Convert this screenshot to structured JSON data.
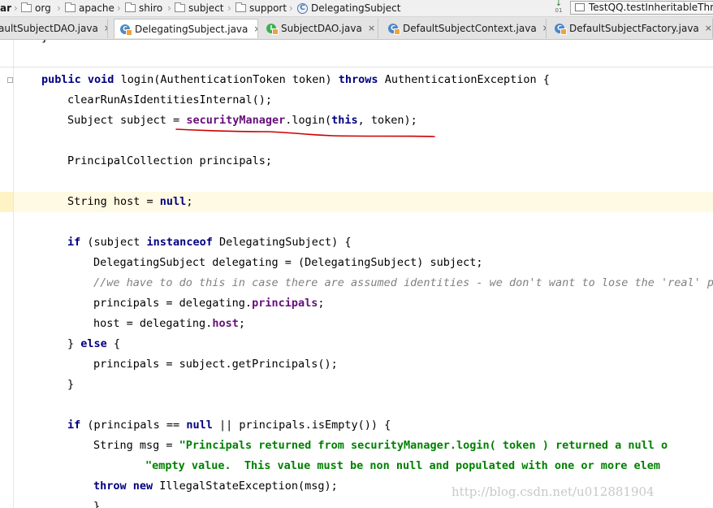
{
  "breadcrumb": {
    "items": [
      {
        "label": "ar",
        "icon": "jar-icon"
      },
      {
        "label": "org",
        "icon": "folder-icon"
      },
      {
        "label": "apache",
        "icon": "folder-icon"
      },
      {
        "label": "shiro",
        "icon": "folder-icon"
      },
      {
        "label": "subject",
        "icon": "folder-icon"
      },
      {
        "label": "support",
        "icon": "folder-icon"
      },
      {
        "label": "DelegatingSubject",
        "icon": "class-icon"
      }
    ]
  },
  "run_config": {
    "label": "TestQQ.testInheritableThre"
  },
  "tabs": [
    {
      "label": "aultSubjectDAO.java",
      "type": "class",
      "active": false
    },
    {
      "label": "DelegatingSubject.java",
      "type": "class",
      "active": true
    },
    {
      "label": "SubjectDAO.java",
      "type": "interface",
      "active": false
    },
    {
      "label": "DefaultSubjectContext.java",
      "type": "class",
      "active": false
    },
    {
      "label": "DefaultSubjectFactory.java",
      "type": "class",
      "active": false
    }
  ],
  "tab_close_glyph": "×",
  "code": {
    "line0": "}",
    "l1_kw1": "public",
    "l1_kw2": "void",
    "l1_a": " login(AuthenticationToken token) ",
    "l1_kw3": "throws",
    "l1_b": " AuthenticationException {",
    "l2": "clearRunAsIdentitiesInternal();",
    "l3_a": "Subject subject = ",
    "l3_fld": "securityManager",
    "l3_b": ".login(",
    "l3_kw": "this",
    "l3_c": ", token);",
    "l4": "PrincipalCollection principals;",
    "l5_a": "String host = ",
    "l5_kw": "null",
    "l5_b": ";",
    "l6_kw1": "if",
    "l6_a": " (subject ",
    "l6_kw2": "instanceof",
    "l6_b": " DelegatingSubject) {",
    "l7": "DelegatingSubject delegating = (DelegatingSubject) subject;",
    "l8": "//we have to do this in case there are assumed identities - we don't want to lose the 'real' pri",
    "l9_a": "principals = delegating.",
    "l9_fld": "principals",
    "l9_b": ";",
    "l10_a": "host = delegating.",
    "l10_fld": "host",
    "l10_b": ";",
    "l11_a": "} ",
    "l11_kw": "else",
    "l11_b": " {",
    "l12": "principals = subject.getPrincipals();",
    "l13": "}",
    "l14_kw1": "if",
    "l14_a": " (principals == ",
    "l14_kw2": "null",
    "l14_b": " || principals.isEmpty()) {",
    "l15_a": "String msg = ",
    "l15_str": "\"Principals returned from securityManager.login( token ) returned a null o",
    "l16_str": "\"empty value.  This value must be non null and populated with one or more elem",
    "l17_kw1": "throw",
    "l17_kw2": "new",
    "l17_a": " IllegalStateException(msg);",
    "l18": "}"
  },
  "watermark": "http://blog.csdn.net/u012881904",
  "colors": {
    "keyword": "#000080",
    "field": "#660e7a",
    "string": "#008000",
    "comment": "#808080",
    "underline": "#cc0000",
    "current_line": "#fffae3"
  }
}
